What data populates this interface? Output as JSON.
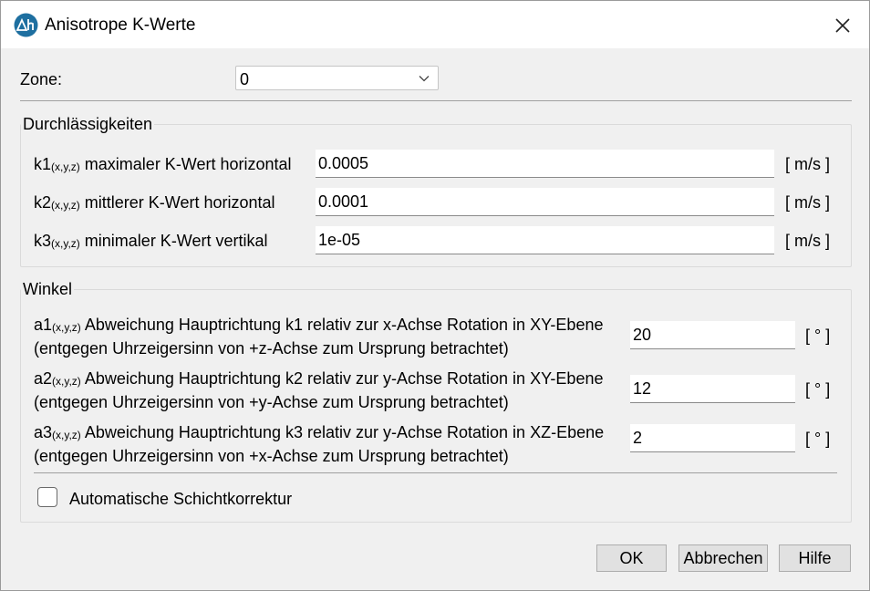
{
  "window": {
    "title": "Anisotrope K-Werte",
    "icons": {
      "app": "delta-h-logo-icon",
      "close": "close-icon"
    },
    "accent_color": "#1e6fa0"
  },
  "zone": {
    "label": "Zone:",
    "value": "0"
  },
  "permeability": {
    "title": "Durchlässigkeiten",
    "rows": [
      {
        "symbol": "k1",
        "sub": "(x,y,z)",
        "desc": " maximaler K-Wert horizontal",
        "value": "0.0005",
        "unit": "[ m/s ]"
      },
      {
        "symbol": "k2",
        "sub": "(x,y,z)",
        "desc": " mittlerer K-Wert horizontal",
        "value": "0.0001",
        "unit": "[ m/s ]"
      },
      {
        "symbol": "k3",
        "sub": "(x,y,z)",
        "desc": " minimaler K-Wert vertikal",
        "value": "1e-05",
        "unit": "[ m/s ]"
      }
    ]
  },
  "angles": {
    "title": "Winkel",
    "rows": [
      {
        "symbol": "a1",
        "sub": "(x,y,z)",
        "line1": " Abweichung Hauptrichtung k1 relativ zur x-Achse Rotation in XY-Ebene",
        "line2": "(entgegen Uhrzeigersinn von +z-Achse zum Ursprung betrachtet)",
        "value": "20",
        "unit": "[ ° ]"
      },
      {
        "symbol": "a2",
        "sub": "(x,y,z)",
        "line1": " Abweichung Hauptrichtung k2 relativ zur y-Achse Rotation in XY-Ebene",
        "line2": "(entgegen Uhrzeigersinn von +y-Achse zum Ursprung betrachtet)",
        "value": "12",
        "unit": "[ ° ]"
      },
      {
        "symbol": "a3",
        "sub": "(x,y,z)",
        "line1": " Abweichung Hauptrichtung k3 relativ zur y-Achse Rotation in XZ-Ebene",
        "line2": "(entgegen Uhrzeigersinn von +x-Achse zum Ursprung betrachtet)",
        "value": "2",
        "unit": "[ ° ]"
      }
    ],
    "checkbox": {
      "label": "Automatische Schichtkorrektur",
      "checked": false
    }
  },
  "buttons": {
    "ok": "OK",
    "cancel": "Abbrechen",
    "help": "Hilfe"
  }
}
